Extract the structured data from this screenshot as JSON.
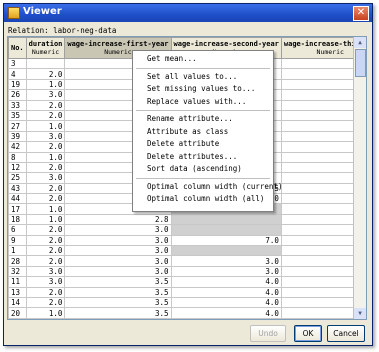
{
  "window": {
    "title": "Viewer",
    "close_glyph": "✕"
  },
  "relation": "Relation: labor-neg-data",
  "table": {
    "columns": [
      {
        "name": "No.",
        "type": ""
      },
      {
        "name": "duration",
        "type": "Numeric"
      },
      {
        "name": "wage-increase-first-year",
        "type": "Numeric"
      },
      {
        "name": "wage-increase-second-year",
        "type": "Numeric"
      },
      {
        "name": "wage-increase-third-ye",
        "type": "Numeric"
      }
    ],
    "rows": [
      [
        "3",
        "",
        "",
        "",
        ""
      ],
      [
        "4",
        "2.0",
        "",
        "",
        ""
      ],
      [
        "19",
        "1.0",
        "",
        "",
        ""
      ],
      [
        "26",
        "3.0",
        "",
        "",
        "2"
      ],
      [
        "33",
        "2.0",
        "",
        "",
        ""
      ],
      [
        "35",
        "2.0",
        "",
        "",
        ""
      ],
      [
        "27",
        "1.0",
        "",
        "",
        ""
      ],
      [
        "39",
        "3.0",
        "",
        "",
        "2"
      ],
      [
        "42",
        "2.0",
        "",
        "",
        ""
      ],
      [
        "8",
        "1.0",
        "",
        "",
        ""
      ],
      [
        "12",
        "2.0",
        "",
        "",
        ""
      ],
      [
        "25",
        "3.0",
        "",
        "",
        ""
      ],
      [
        "43",
        "2.0",
        "2.5",
        "2.5",
        ""
      ],
      [
        "44",
        "2.0",
        "2.5",
        "3.0",
        ""
      ],
      [
        "17",
        "1.0",
        "2.8",
        "",
        ""
      ],
      [
        "18",
        "1.0",
        "2.8",
        "",
        ""
      ],
      [
        "6",
        "2.0",
        "3.0",
        "",
        ""
      ],
      [
        "9",
        "2.0",
        "3.0",
        "7.0",
        ""
      ],
      [
        "1",
        "2.0",
        "3.0",
        "",
        ""
      ],
      [
        "28",
        "2.0",
        "3.0",
        "3.0",
        ""
      ],
      [
        "32",
        "3.0",
        "3.0",
        "3.0",
        "2"
      ],
      [
        "11",
        "3.0",
        "3.5",
        "4.0",
        "4"
      ],
      [
        "13",
        "2.0",
        "3.5",
        "4.0",
        ""
      ],
      [
        "14",
        "2.0",
        "3.5",
        "4.0",
        "2"
      ],
      [
        "20",
        "1.0",
        "3.5",
        "4.0",
        ""
      ]
    ]
  },
  "context_menu": [
    "Get mean...",
    "Set all values to...",
    "Set missing values to...",
    "Replace values with...",
    "Rename attribute...",
    "Attribute as class",
    "Delete attribute",
    "Delete attributes...",
    "Sort data (ascending)",
    "Optimal column width (current)",
    "Optimal column width (all)"
  ],
  "buttons": {
    "undo": "Undo",
    "ok": "OK",
    "cancel": "Cancel"
  },
  "colors": {
    "titlebar": "#1f4fc8",
    "missing_cell": "#d0d0d0",
    "window_bg": "#ece9d8"
  }
}
